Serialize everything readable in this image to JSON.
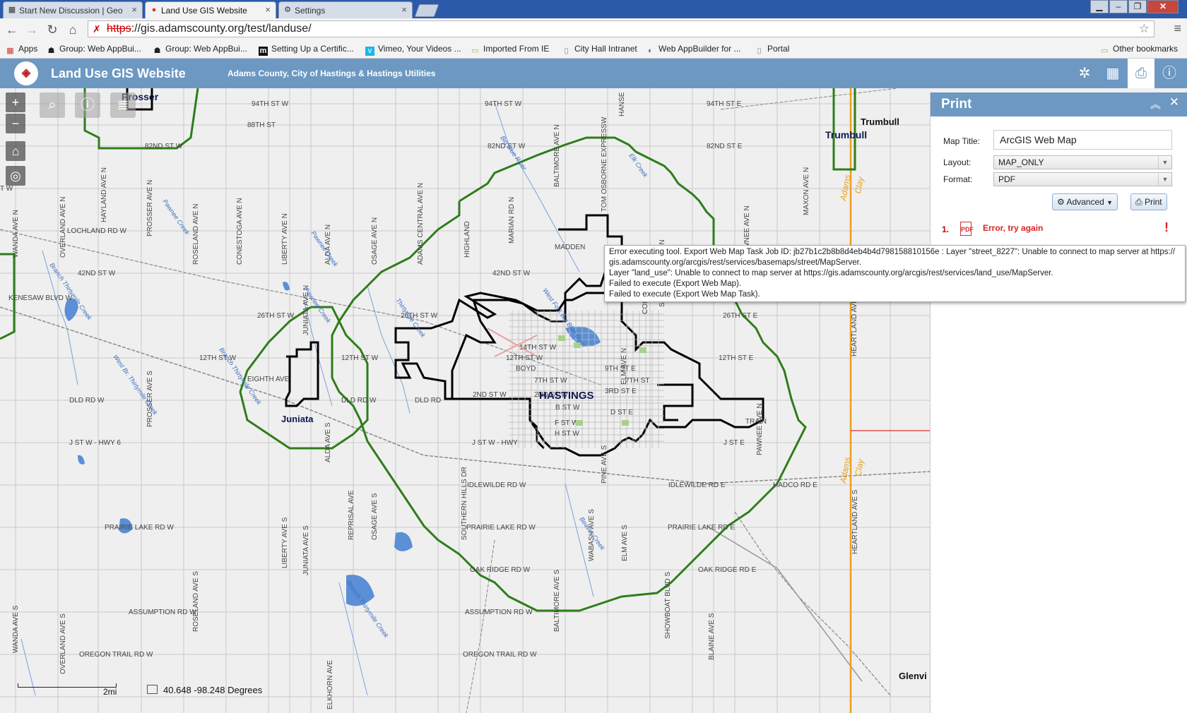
{
  "browser": {
    "tabs": [
      {
        "label": "Start New Discussion | Geo",
        "icon": "geonet-icon"
      },
      {
        "label": "Land Use GIS Website",
        "icon": "map-pin-icon"
      },
      {
        "label": "Settings",
        "icon": "gear-icon"
      }
    ],
    "url_scheme": "https",
    "url_rest": "://gis.adamscounty.org/test/landuse/",
    "bookmarks": [
      {
        "label": "Apps"
      },
      {
        "label": "Group: Web AppBui..."
      },
      {
        "label": "Group: Web AppBui..."
      },
      {
        "label": "Setting Up a Certific..."
      },
      {
        "label": "Vimeo, Your Videos ..."
      },
      {
        "label": "Imported From IE"
      },
      {
        "label": "City Hall Intranet"
      },
      {
        "label": "Web AppBuilder for ..."
      },
      {
        "label": "Portal"
      }
    ],
    "other_bookmarks": "Other bookmarks"
  },
  "app": {
    "title": "Land Use GIS Website",
    "subtitle": "Adams County, City of Hastings & Hastings Utilities",
    "header_color": "#6c98c2"
  },
  "map": {
    "coords_lat": "40.648",
    "coords_lon": "-98.248",
    "coords_unit": "Degrees",
    "scale_label": "2mi",
    "towns": {
      "hastings": "HASTINGS",
      "juniata": "Juniata",
      "trumbull": "Trumbull",
      "trumbull_label": "Trumbull",
      "prosser": "Prosser",
      "glenvil": "Glenvi"
    },
    "roads_horizontal": [
      {
        "label": "94TH ST W"
      },
      {
        "label": "88TH ST"
      },
      {
        "label": "82ND ST W"
      },
      {
        "label": "LOCHLAND RD W"
      },
      {
        "label": "42ND ST W"
      },
      {
        "label": "KENESAW BLVD W"
      },
      {
        "label": "26TH ST W"
      },
      {
        "label": "12TH ST W"
      },
      {
        "label": "DLD RD W"
      },
      {
        "label": "J ST W - HWY 6"
      },
      {
        "label": "PRAIRIE LAKE RD W"
      },
      {
        "label": "ASSUMPTION RD W"
      },
      {
        "label": "OREGON TRAIL RD W"
      },
      {
        "label": "94TH ST W"
      },
      {
        "label": "82ND ST W"
      },
      {
        "label": "42ND ST W"
      },
      {
        "label": "26TH ST W"
      },
      {
        "label": "12TH ST W"
      },
      {
        "label": "DLD RD W"
      },
      {
        "label": "DLD RD"
      },
      {
        "label": "2ND ST W"
      },
      {
        "label": "J ST W - HWY"
      },
      {
        "label": "IDLEWILDE RD W"
      },
      {
        "label": "PRAIRIE LAKE RD W"
      },
      {
        "label": "OAK RIDGE RD W"
      },
      {
        "label": "ASSUMPTION RD W"
      },
      {
        "label": "OREGON TRAIL RD W"
      },
      {
        "label": "EIGHTH AVE"
      },
      {
        "label": "94TH ST E"
      },
      {
        "label": "82ND ST E"
      },
      {
        "label": "26TH ST E"
      },
      {
        "label": "12TH ST E"
      },
      {
        "label": "J ST E"
      },
      {
        "label": "IDLEWILDE RD E"
      },
      {
        "label": "PRAIRIE LAKE RD E"
      },
      {
        "label": "OAK RIDGE RD E"
      },
      {
        "label": "HADCO RD E"
      },
      {
        "label": "14TH ST W"
      },
      {
        "label": "12TH ST W"
      },
      {
        "label": "7TH ST W"
      },
      {
        "label": "2ND ST W"
      },
      {
        "label": "B ST W"
      },
      {
        "label": "F ST W"
      },
      {
        "label": "H ST W"
      },
      {
        "label": "9TH ST E"
      },
      {
        "label": "7TH ST"
      },
      {
        "label": "3RD ST E"
      },
      {
        "label": "D ST E"
      },
      {
        "label": "MADDEN"
      },
      {
        "label": "TRAIN"
      },
      {
        "label": "T W"
      },
      {
        "label": "BOYD"
      }
    ],
    "roads_vertical": [
      {
        "label": "WANDA AVE N"
      },
      {
        "label": "OVERLAND AVE N"
      },
      {
        "label": "HAYLAND AVE N"
      },
      {
        "label": "PROSSER AVE N"
      },
      {
        "label": "ROSELAND AVE N"
      },
      {
        "label": "CONESTOGA AVE N"
      },
      {
        "label": "LIBERTY AVE N"
      },
      {
        "label": "ALDA AVE N"
      },
      {
        "label": "OSAGE AVE N"
      },
      {
        "label": "ADAMS CENTRAL AVE N"
      },
      {
        "label": "HIGHLAND"
      },
      {
        "label": "MARIAN RD N"
      },
      {
        "label": "BALTIMORE AVE N"
      },
      {
        "label": "TOM OSBORNE EXPRESSW"
      },
      {
        "label": "HANSE"
      },
      {
        "label": "SHOWBOAT BLVD N"
      },
      {
        "label": "PAWNEE AVE N"
      },
      {
        "label": "MAXON AVE N"
      },
      {
        "label": "OVERLAND AVE S"
      },
      {
        "label": "PROSSER AVE S"
      },
      {
        "label": "ROSELAND AVE S"
      },
      {
        "label": "LIBERTY AVE S"
      },
      {
        "label": "JUNIATA AVE S"
      },
      {
        "label": "ALDA AVE S"
      },
      {
        "label": "REPRISAL AVE"
      },
      {
        "label": "OSAGE AVE S"
      },
      {
        "label": "SOUTHERN HILLS DR"
      },
      {
        "label": "WABASH AVE S"
      },
      {
        "label": "ELM AVE S"
      },
      {
        "label": "PINE AVE S"
      },
      {
        "label": "BALTIMORE AVE S"
      },
      {
        "label": "SHOWBOAT BLVD S"
      },
      {
        "label": "BLAINE AVE S"
      },
      {
        "label": "HEARTLAND AVE S"
      },
      {
        "label": "WANDA AVE S"
      },
      {
        "label": "ELKHORN AVE"
      },
      {
        "label": "PAWNEE AVE N"
      },
      {
        "label": "ELM AVE N"
      },
      {
        "label": "HEARTLAND AVE N"
      },
      {
        "label": "COLU"
      },
      {
        "label": "JUNIATA AVE N"
      }
    ],
    "waterways": [
      {
        "label": "Pawnee Creek"
      },
      {
        "label": "Pawnee Creek"
      },
      {
        "label": "Branch Thirtymile Creek"
      },
      {
        "label": "West Fork Big Blue River"
      },
      {
        "label": "Thirtymile Creek"
      },
      {
        "label": "West Br. Thirtymile Creek"
      },
      {
        "label": "Branch Thirtymile Creek"
      },
      {
        "label": "Beaver Creek"
      },
      {
        "label": "Pawnee Creek"
      },
      {
        "label": "Elk Creek"
      },
      {
        "label": "Big Blue River"
      },
      {
        "label": "Branch Thirtymile Creek"
      }
    ],
    "county_labels": {
      "adams_1": "Adams",
      "clay_1": "Clay",
      "adams_2": "Adams",
      "clay_2": "Clay"
    },
    "colors": {
      "boundary_green": "#2e7d1a",
      "city_limits": "#000000",
      "county_line": "#e8a020",
      "water": "#5b8fd6",
      "road": "#c8c8c8"
    }
  },
  "print": {
    "title": "Print",
    "map_title_label": "Map Title:",
    "map_title_value": "ArcGIS Web Map",
    "layout_label": "Layout:",
    "layout_value": "MAP_ONLY",
    "format_label": "Format:",
    "format_value": "PDF",
    "advanced_label": "Advanced",
    "print_label": "Print",
    "result_number": "1.",
    "result_text": "Error, try again",
    "result_mark": "!"
  },
  "tooltip": {
    "lines": [
      "Error executing tool. Export Web Map Task Job ID: jb27b1c2b8b8d4eb4b4d798158810156e : Layer \"street_8227\": Unable to connect to map server at https://",
      "gis.adamscounty.org/arcgis/rest/services/basemaps/street/MapServer.",
      "Layer \"land_use\": Unable to connect to map server at https://gis.adamscounty.org/arcgis/rest/services/land_use/MapServer.",
      "Failed to execute (Export Web Map).",
      "Failed to execute (Export Web Map Task)."
    ]
  }
}
